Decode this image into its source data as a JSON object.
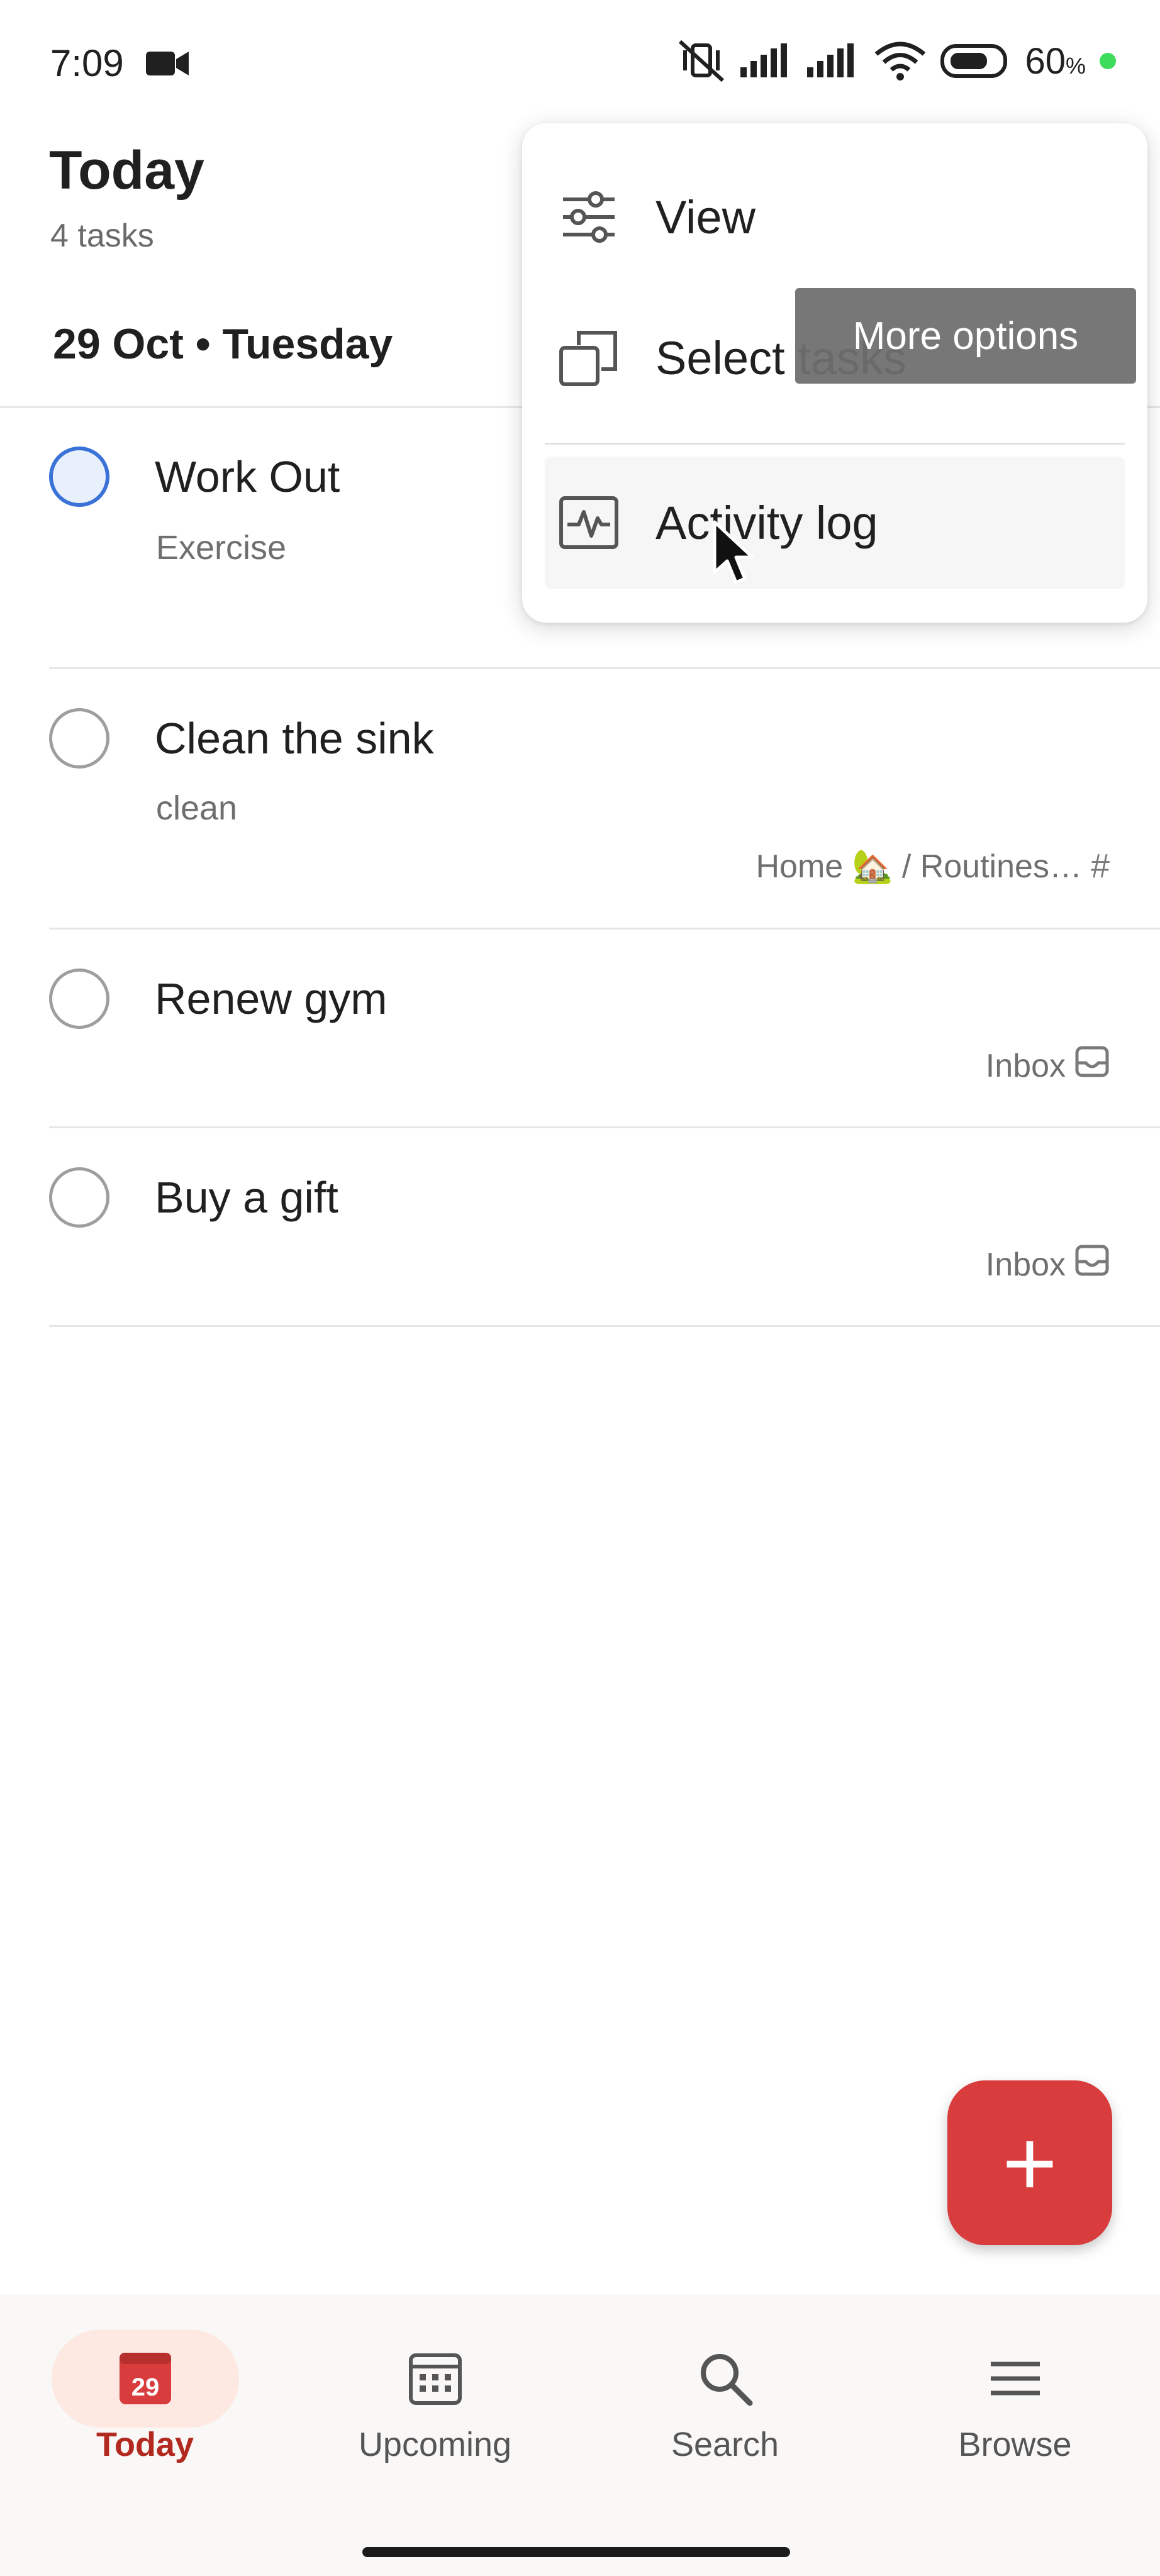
{
  "status_bar": {
    "time": "7:09",
    "battery_percent": "60",
    "battery_sign": "%"
  },
  "header": {
    "title": "Today",
    "task_count": "4 tasks",
    "date_label": "29 Oct • Tuesday"
  },
  "tasks": [
    {
      "title": "Work Out",
      "description": "Exercise",
      "project": "",
      "active": true
    },
    {
      "title": "Clean the sink",
      "description": "clean",
      "project": "Home 🏡 / Routines…"
    },
    {
      "title": "Renew gym",
      "description": "",
      "project": "Inbox"
    },
    {
      "title": "Buy a gift",
      "description": "",
      "project": "Inbox"
    }
  ],
  "menu": {
    "items": [
      {
        "label": "View",
        "icon": "sliders-icon"
      },
      {
        "label": "Select tasks",
        "icon": "copy-icon"
      },
      {
        "label": "Activity log",
        "icon": "activity-icon"
      }
    ]
  },
  "tooltip": {
    "text": "More options"
  },
  "fab": {
    "label": "+"
  },
  "nav": {
    "items": [
      {
        "label": "Today",
        "icon": "calendar-today-icon",
        "badge": "29",
        "active": true
      },
      {
        "label": "Upcoming",
        "icon": "calendar-grid-icon"
      },
      {
        "label": "Search",
        "icon": "search-icon"
      },
      {
        "label": "Browse",
        "icon": "menu-icon"
      }
    ]
  },
  "colors": {
    "accent_red": "#d93c3c",
    "nav_active": "#b2291f",
    "checkbox_active": "#3a72d8"
  }
}
